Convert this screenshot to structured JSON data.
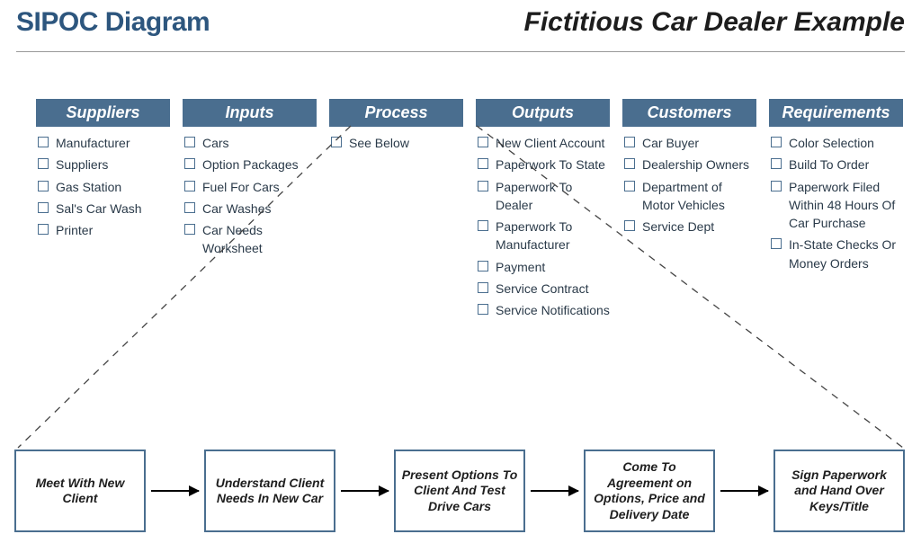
{
  "header": {
    "title": "SIPOC Diagram",
    "subtitle": "Fictitious Car Dealer Example"
  },
  "columns": [
    {
      "label": "Suppliers",
      "items": [
        "Manufacturer",
        "Suppliers",
        "Gas Station",
        "Sal's Car Wash",
        "Printer"
      ]
    },
    {
      "label": "Inputs",
      "items": [
        "Cars",
        "Option Packages",
        "Fuel For Cars",
        "Car Washes",
        "Car Needs Worksheet"
      ]
    },
    {
      "label": "Process",
      "items": [
        "See Below"
      ]
    },
    {
      "label": "Outputs",
      "items": [
        "New Client Account",
        "Paperwork To State",
        "Paperwork To Dealer",
        "Paperwork To Manufacturer",
        "Payment",
        "Service Contract",
        "Service Notifications"
      ]
    },
    {
      "label": "Customers",
      "items": [
        "Car Buyer",
        "Dealership Owners",
        "Department of Motor Vehicles",
        "Service Dept"
      ]
    },
    {
      "label": "Requirements",
      "items": [
        "Color Selection",
        "Build To Order",
        "Paperwork Filed Within 48 Hours Of Car Purchase",
        "In-State Checks Or Money Orders"
      ]
    }
  ],
  "process_steps": [
    "Meet With New Client",
    "Understand Client Needs In New Car",
    "Present Options To Client And Test Drive Cars",
    "Come To Agreement on Options, Price and Delivery Date",
    "Sign Paperwork and Hand Over Keys/Title"
  ],
  "colors": {
    "heading_blue": "#2d567e",
    "box_blue": "#4a6e8f"
  }
}
